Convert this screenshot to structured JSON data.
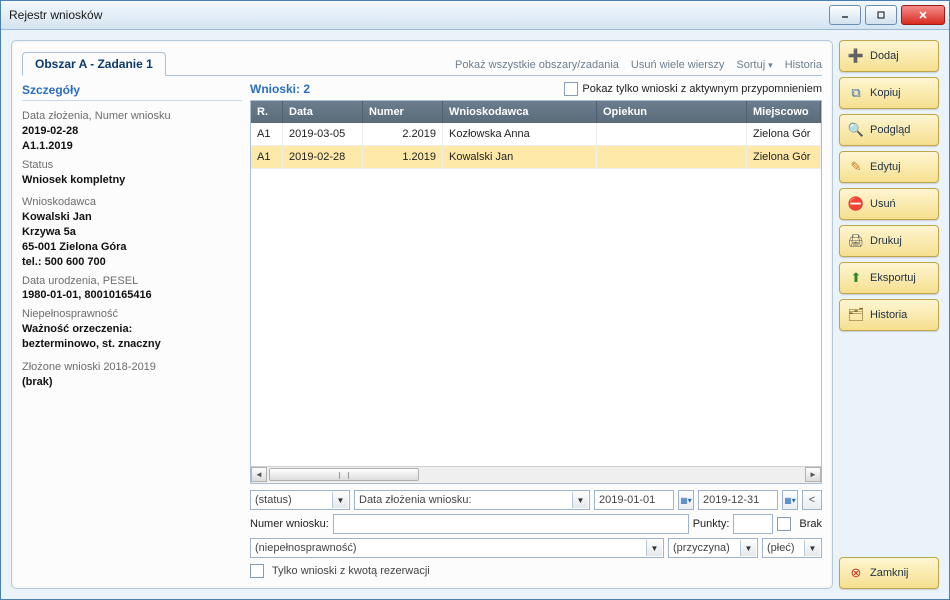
{
  "window": {
    "title": "Rejestr wniosków"
  },
  "tab": {
    "label": "Obszar A - Zadanie 1"
  },
  "topLinks": {
    "showAll": "Pokaż wszystkie obszary/zadania",
    "deleteMany": "Usuń wiele wierszy",
    "sort": "Sortuj",
    "history": "Historia"
  },
  "details": {
    "header": "Szczegóły",
    "submissionLabel": "Data złożenia, Numer wniosku",
    "submissionDate": "2019-02-28",
    "submissionNumber": "A1.1.2019",
    "statusLabel": "Status",
    "statusValue": "Wniosek kompletny",
    "applicantLabel": "Wnioskodawca",
    "applicantName": "Kowalski Jan",
    "applicantStreet": "Krzywa 5a",
    "applicantCity": "65-001 Zielona Góra",
    "applicantPhone": "tel.: 500 600 700",
    "dobLabel": "Data urodzenia, PESEL",
    "dobValue": "1980-01-01,  80010165416",
    "disabilityLabel": "Niepełnosprawność",
    "disabilityLine1": "Ważność orzeczenia:",
    "disabilityLine2": "bezterminowo, st. znaczny",
    "submittedLabel": "Złożone wnioski 2018-2019",
    "submittedValue": "(brak)"
  },
  "list": {
    "header": "Wnioski: 2",
    "activeReminderLabel": "Pokaz tylko wnioski z aktywnym przypomnieniem",
    "columns": {
      "r": "R.",
      "data": "Data",
      "numer": "Numer",
      "wnioskodawca": "Wnioskodawca",
      "opiekun": "Opiekun",
      "miejscowosc": "Miejscowo"
    },
    "rows": [
      {
        "r": "A1",
        "data": "2019-03-05",
        "numer": "2.2019",
        "wnioskodawca": "Kozłowska Anna",
        "opiekun": "",
        "miejscowosc": "Zielona Gór"
      },
      {
        "r": "A1",
        "data": "2019-02-28",
        "numer": "1.2019",
        "wnioskodawca": "Kowalski Jan",
        "opiekun": "",
        "miejscowosc": "Zielona Gór"
      }
    ]
  },
  "filters": {
    "status": "(status)",
    "dateFieldLabel": "Data złożenia wniosku:",
    "dateFrom": "2019-01-01",
    "dateTo": "2019-12-31",
    "numerLabel": "Numer wniosku:",
    "punktyLabel": "Punkty:",
    "brakLabel": "Brak",
    "disabilityCombo": "(niepełnosprawność)",
    "reasonCombo": "(przyczyna)",
    "genderCombo": "(płeć)",
    "reservationLabel": "Tylko wnioski z kwotą rezerwacji"
  },
  "actions": {
    "add": "Dodaj",
    "copy": "Kopiuj",
    "view": "Podgląd",
    "edit": "Edytuj",
    "delete": "Usuń",
    "print": "Drukuj",
    "export": "Eksportuj",
    "history": "Historia",
    "close": "Zamknij"
  }
}
